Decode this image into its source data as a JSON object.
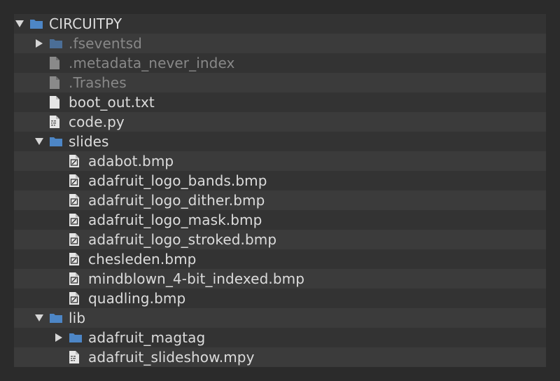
{
  "tree": {
    "root": {
      "label": "CIRCUITPY",
      "expanded": true
    },
    "items": [
      {
        "label": ".fseventsd",
        "type": "folder",
        "indent": 1,
        "expandable": true,
        "expanded": false,
        "muted": true
      },
      {
        "label": ".metadata_never_index",
        "type": "file",
        "indent": 1,
        "muted": true
      },
      {
        "label": ".Trashes",
        "type": "file",
        "indent": 1,
        "muted": true
      },
      {
        "label": "boot_out.txt",
        "type": "file",
        "indent": 1
      },
      {
        "label": "code.py",
        "type": "script",
        "indent": 1
      },
      {
        "label": "slides",
        "type": "folder",
        "indent": 1,
        "expandable": true,
        "expanded": true
      },
      {
        "label": "adabot.bmp",
        "type": "image",
        "indent": 2
      },
      {
        "label": "adafruit_logo_bands.bmp",
        "type": "image",
        "indent": 2
      },
      {
        "label": "adafruit_logo_dither.bmp",
        "type": "image",
        "indent": 2
      },
      {
        "label": "adafruit_logo_mask.bmp",
        "type": "image",
        "indent": 2
      },
      {
        "label": "adafruit_logo_stroked.bmp",
        "type": "image",
        "indent": 2
      },
      {
        "label": "chesleden.bmp",
        "type": "image",
        "indent": 2
      },
      {
        "label": "mindblown_4-bit_indexed.bmp",
        "type": "image",
        "indent": 2
      },
      {
        "label": "quadling.bmp",
        "type": "image",
        "indent": 2
      },
      {
        "label": "lib",
        "type": "folder",
        "indent": 1,
        "expandable": true,
        "expanded": true
      },
      {
        "label": "adafruit_magtag",
        "type": "folder",
        "indent": 2,
        "expandable": true,
        "expanded": false
      },
      {
        "label": "adafruit_slideshow.mpy",
        "type": "script",
        "indent": 2
      }
    ]
  },
  "colors": {
    "folder": "#4d86c6",
    "folder_muted": "#4b6e96",
    "file": "#e6e6e6",
    "file_muted": "#8a8a8a"
  }
}
